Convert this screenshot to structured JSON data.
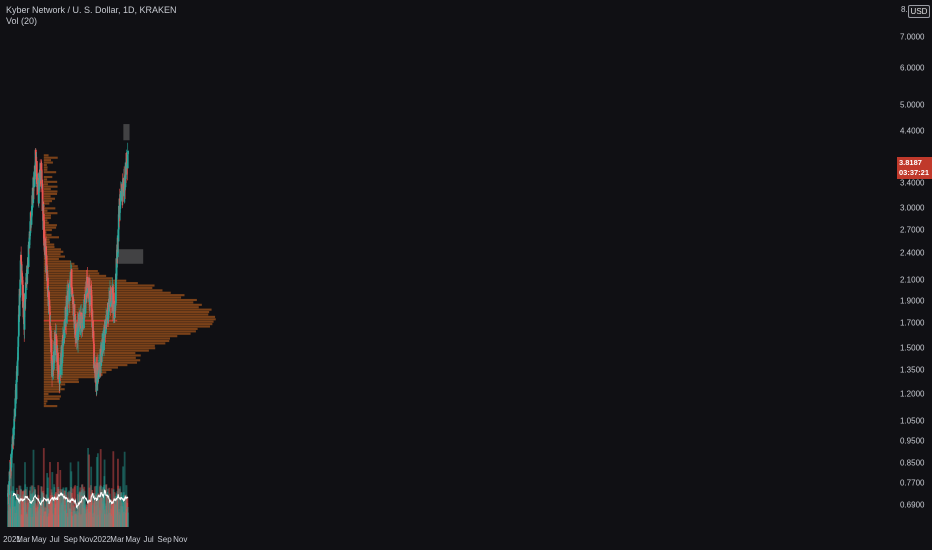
{
  "legend": {
    "symbol_title": "Kyber Network / U. S. Dollar, 1D, KRAKEN",
    "volume_indicator": "Vol (20)"
  },
  "price_axis": {
    "currency": "USD",
    "top_partial": "8.",
    "labels": [
      "7.0000",
      "6.0000",
      "5.0000",
      "4.4000",
      "3.4000",
      "3.0000",
      "2.7000",
      "2.4000",
      "2.1000",
      "1.9000",
      "1.7000",
      "1.5000",
      "1.3500",
      "1.2000",
      "1.0500",
      "0.9500",
      "0.8500",
      "0.7700",
      "0.6900"
    ],
    "label_values": [
      7.0,
      6.0,
      5.0,
      4.4,
      3.4,
      3.0,
      2.7,
      2.4,
      2.1,
      1.9,
      1.7,
      1.5,
      1.35,
      1.2,
      1.05,
      0.95,
      0.85,
      0.77,
      0.69
    ],
    "last_price": "3.8187",
    "countdown": "03:37:21"
  },
  "time_axis": {
    "labels": [
      "2021",
      "Mar",
      "May",
      "Jul",
      "Sep",
      "Nov",
      "2022",
      "Mar",
      "May",
      "Jul",
      "Sep",
      "Nov"
    ]
  },
  "colors": {
    "background": "#101014",
    "up": "#26a69a",
    "down": "#ef5350",
    "volume_ma": "#ffffff",
    "profile": "#d2691e",
    "poc_line": "#e53935",
    "zone": "#6b6b6b",
    "last_price": "#c0392b"
  },
  "chart_data": {
    "type": "candlestick",
    "title": "Kyber Network / U. S. Dollar, 1D, KRAKEN",
    "y_scale": "log",
    "ylim": [
      0.62,
      8.0
    ],
    "period": {
      "start": "2021-01-01",
      "end": "2022-04-12",
      "interval": "1D"
    },
    "approximate_close_path": [
      {
        "date": "2021-01-01",
        "close": 0.72
      },
      {
        "date": "2021-01-20",
        "close": 0.95
      },
      {
        "date": "2021-02-05",
        "close": 1.3
      },
      {
        "date": "2021-02-20",
        "close": 2.3
      },
      {
        "date": "2021-03-05",
        "close": 1.75
      },
      {
        "date": "2021-03-18",
        "close": 2.25
      },
      {
        "date": "2021-04-05",
        "close": 3.1
      },
      {
        "date": "2021-04-18",
        "close": 3.85
      },
      {
        "date": "2021-04-28",
        "close": 3.2
      },
      {
        "date": "2021-05-10",
        "close": 3.6
      },
      {
        "date": "2021-05-20",
        "close": 2.7
      },
      {
        "date": "2021-06-05",
        "close": 2.05
      },
      {
        "date": "2021-06-22",
        "close": 1.35
      },
      {
        "date": "2021-07-05",
        "close": 1.55
      },
      {
        "date": "2021-07-20",
        "close": 1.28
      },
      {
        "date": "2021-08-05",
        "close": 1.62
      },
      {
        "date": "2021-08-22",
        "close": 1.92
      },
      {
        "date": "2021-09-05",
        "close": 2.15
      },
      {
        "date": "2021-09-20",
        "close": 1.6
      },
      {
        "date": "2021-10-05",
        "close": 1.68
      },
      {
        "date": "2021-10-20",
        "close": 1.72
      },
      {
        "date": "2021-11-05",
        "close": 2.1
      },
      {
        "date": "2021-11-20",
        "close": 1.9
      },
      {
        "date": "2021-12-05",
        "close": 1.3
      },
      {
        "date": "2021-12-20",
        "close": 1.35
      },
      {
        "date": "2022-01-05",
        "close": 1.55
      },
      {
        "date": "2022-01-20",
        "close": 1.7
      },
      {
        "date": "2022-02-05",
        "close": 2.0
      },
      {
        "date": "2022-02-20",
        "close": 1.8
      },
      {
        "date": "2022-03-01",
        "close": 2.45
      },
      {
        "date": "2022-03-10",
        "close": 3.0
      },
      {
        "date": "2022-03-20",
        "close": 3.2
      },
      {
        "date": "2022-04-01",
        "close": 3.5
      },
      {
        "date": "2022-04-12",
        "close": 3.82
      }
    ],
    "volume_profile_poc": 1.72,
    "zones": [
      {
        "price_low": 4.2,
        "price_high": 4.55
      },
      {
        "price_low": 2.28,
        "price_high": 2.45
      }
    ],
    "volume_ma_length": 20
  }
}
